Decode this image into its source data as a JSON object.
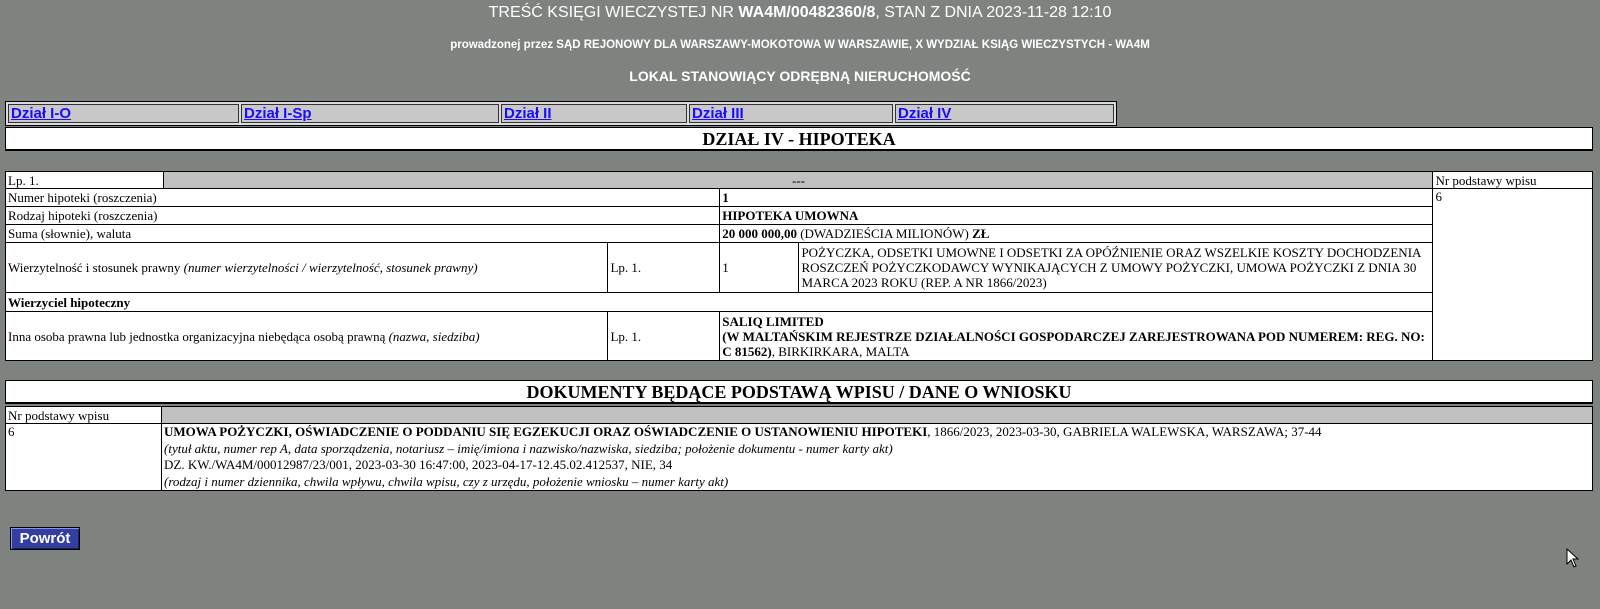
{
  "header": {
    "line1_prefix": "TREŚĆ KSIĘGI WIECZYSTEJ NR ",
    "kw_number": "WA4M/00482360/8",
    "line1_suffix": ", STAN Z DNIA 2023-11-28 12:10",
    "line2": "prowadzonej przez SĄD REJONOWY DLA WARSZAWY-MOKOTOWA W WARSZAWIE, X WYDZIAŁ KSIĄG WIECZYSTYCH - WA4M",
    "line3": "LOKAL STANOWIĄCY ODRĘBNĄ NIERUCHOMOŚĆ"
  },
  "tabs": [
    {
      "label": "Dział I-O"
    },
    {
      "label": "Dział I-Sp"
    },
    {
      "label": "Dział II"
    },
    {
      "label": "Dział III"
    },
    {
      "label": "Dział IV"
    }
  ],
  "section_title": "DZIAŁ IV - HIPOTEKA",
  "hipoteka": {
    "lp": "Lp. 1.",
    "lp_value": "---",
    "nr_podstawy_label": "Nr podstawy wpisu",
    "nr_podstawy_value": "6",
    "numer_label": "Numer hipoteki (roszczenia)",
    "numer_value": "1",
    "rodzaj_label": "Rodzaj hipoteki (roszczenia)",
    "rodzaj_value": "HIPOTEKA UMOWNA",
    "suma_label": "Suma (słownie), waluta",
    "suma_amount": "20 000 000,00",
    "suma_words": " (DWADZIEŚCIA MILIONÓW) ",
    "suma_currency": "ZŁ",
    "wierz_label": "Wierzytelność i stosunek prawny ",
    "wierz_label_italic": "(numer wierzytelności / wierzytelność, stosunek prawny)",
    "wierz_lp": "Lp. 1.",
    "wierz_num": "1",
    "wierz_text": "POŻYCZKA, ODSETKI UMOWNE I ODSETKI ZA OPÓŹNIENIE ORAZ WSZELKIE KOSZTY DOCHODZENIA ROSZCZEŃ POŻYCZKODAWCY WYNIKAJĄCYCH Z UMOWY POŻYCZKI, UMOWA POŻYCZKI Z DNIA 30 MARCA 2023 ROKU (REP. A NR 1866/2023)",
    "wierzyciel_header": "Wierzyciel hipoteczny",
    "inna_label": "Inna osoba prawna lub jednostka organizacyjna niebędąca osobą prawną ",
    "inna_label_italic": "(nazwa, siedziba)",
    "inna_lp": "Lp. 1.",
    "inna_name": "SALIQ LIMITED",
    "inna_reg": "(W MALTAŃSKIM REJESTRZE DZIAŁALNOŚCI GOSPODARCZEJ ZAREJESTROWANA POD NUMEREM: REG. NO: C 81562)",
    "inna_city": ", BIRKIRKARA, MALTA"
  },
  "documents_title": "DOKUMENTY BĘDĄCE PODSTAWĄ WPISU / DANE O WNIOSKU",
  "documents": {
    "nr_label": "Nr podstawy wpisu",
    "nr_value": "6",
    "doc_title": "UMOWA POŻYCZKI, OŚWIADCZENIE O PODDANIU SIĘ EGZEKUCJI ORAZ OŚWIADCZENIE O USTANOWIENIU HIPOTEKI",
    "doc_details": ", 1866/2023, 2023-03-30, GABRIELA WALEWSKA, WARSZAWA; 37-44",
    "doc_hint": "(tytuł aktu, numer rep A, data sporządzenia, notariusz – imię/imiona i nazwisko/nazwiska, siedziba; położenie dokumentu - numer karty akt)",
    "wniosek": "DZ. KW./WA4M/00012987/23/001, 2023-03-30 16:47:00, 2023-04-17-12.45.02.412537, NIE, 34",
    "wniosek_hint": "(rodzaj i numer dziennika, chwila wpływu, chwila wpisu, czy z urzędu, położenie wniosku – numer karty akt)"
  },
  "back_button": "Powrót",
  "icons": {
    "cursor": "mouse-pointer-icon"
  }
}
